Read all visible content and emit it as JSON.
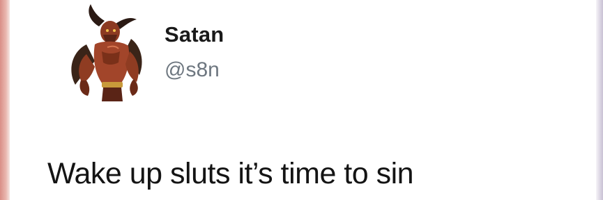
{
  "tweet": {
    "author": {
      "display_name": "Satan",
      "handle": "@s8n",
      "avatar_icon": "horned-demon-avatar"
    },
    "text": "Wake up sluts it’s time to sin"
  },
  "colors": {
    "background": "#ffffff",
    "name_text": "#1a1a1a",
    "handle_text": "#6e7780",
    "body_text": "#141414"
  }
}
